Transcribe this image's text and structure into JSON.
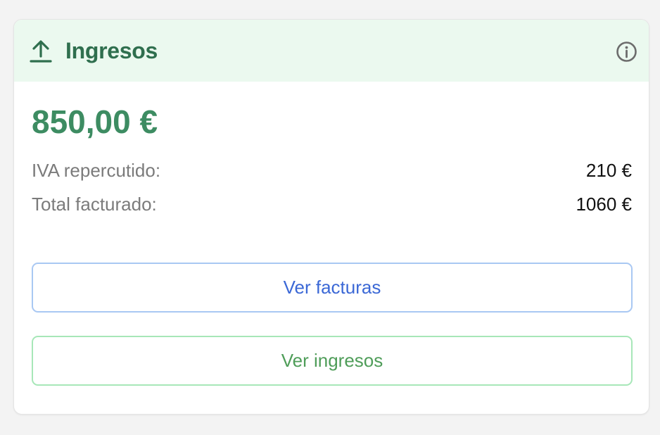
{
  "card": {
    "title": "Ingresos",
    "icons": {
      "header": "upload-arrow-icon",
      "info": "info-circle-icon"
    },
    "amount": "850,00 €",
    "rows": [
      {
        "label": "IVA repercutido:",
        "value": "210 €"
      },
      {
        "label": "Total facturado:",
        "value": "1060 €"
      }
    ],
    "buttons": {
      "invoices": "Ver facturas",
      "income": "Ver ingresos"
    }
  },
  "colors": {
    "header_background": "#ebf9ef",
    "title": "#2f6f4e",
    "amount": "#3d8c62",
    "invoices_button_text": "#3b68d6",
    "invoices_button_border": "#a9c8f3",
    "income_button_text": "#4f9d59",
    "income_button_border": "#a7e7b8"
  }
}
